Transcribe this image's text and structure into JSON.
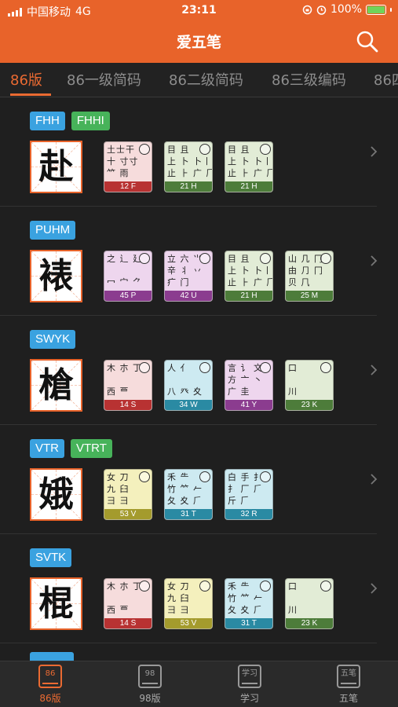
{
  "status": {
    "carrier": "中国移动",
    "network": "4G",
    "time": "23:11",
    "battery": "100%"
  },
  "nav": {
    "title": "爱五笔"
  },
  "tabs": [
    "86版",
    "86一级简码",
    "86二级简码",
    "86三级编码",
    "86四"
  ],
  "rows": [
    {
      "char": "赴",
      "codes": [
        {
          "text": "FHH",
          "color": "blue"
        },
        {
          "text": "FHHI",
          "color": "green"
        }
      ],
      "keys": [
        {
          "label": "12 F",
          "theme": "red",
          "glyphs": "土士干\n十 寸寸\n⺮ 雨"
        },
        {
          "label": "21 H",
          "theme": "green",
          "glyphs": "目 且\n上 卜 卜丨\n止 ⺊ 广 𠂆"
        },
        {
          "label": "21 H",
          "theme": "green",
          "glyphs": "目 且\n上 卜 卜丨\n止 ⺊ 广 𠂆"
        }
      ]
    },
    {
      "char": "裱",
      "codes": [
        {
          "text": "PUHM",
          "color": "blue"
        }
      ],
      "keys": [
        {
          "label": "45 P",
          "theme": "purple",
          "glyphs": "之 辶 廴\n\n冖 宀 ⺈"
        },
        {
          "label": "42 U",
          "theme": "purple",
          "glyphs": "立 六 ⺌\n辛 丬 丷\n疒 门"
        },
        {
          "label": "21 H",
          "theme": "green",
          "glyphs": "目 且\n上 卜 卜丨\n止 ⺊ 广 𠂆"
        },
        {
          "label": "25 M",
          "theme": "green",
          "glyphs": "山 几 冂\n由 ⺆ 冂\n贝 𠘨"
        }
      ]
    },
    {
      "char": "槍",
      "codes": [
        {
          "text": "SWYK",
          "color": "blue"
        }
      ],
      "keys": [
        {
          "label": "14 S",
          "theme": "red",
          "glyphs": "木 朩 丁\n\n西 覀"
        },
        {
          "label": "34 W",
          "theme": "blue",
          "glyphs": "人 亻\n\n八 癶 夊"
        },
        {
          "label": "41 Y",
          "theme": "purple",
          "glyphs": "言 讠 文\n方 亠 丶\n广 圭"
        },
        {
          "label": "23 K",
          "theme": "green",
          "glyphs": "口\n\n川"
        }
      ]
    },
    {
      "char": "娥",
      "codes": [
        {
          "text": "VTR",
          "color": "blue"
        },
        {
          "text": "VTRT",
          "color": "green"
        }
      ],
      "keys": [
        {
          "label": "53 V",
          "theme": "yellow",
          "glyphs": "女 刀\n九 臼\n彐 ⺕"
        },
        {
          "label": "31 T",
          "theme": "blue",
          "glyphs": "禾 ⺧\n竹 ⺮ 𠂉\n夂 夊 ⺁"
        },
        {
          "label": "32 R",
          "theme": "blue",
          "glyphs": "白 手 ⺘\n扌 厂 ⺁\n斤 𠂆"
        }
      ]
    },
    {
      "char": "棍",
      "codes": [
        {
          "text": "SVTK",
          "color": "blue"
        }
      ],
      "keys": [
        {
          "label": "14 S",
          "theme": "red",
          "glyphs": "木 朩 丁\n\n西 覀"
        },
        {
          "label": "53 V",
          "theme": "yellow",
          "glyphs": "女 刀\n九 臼\n彐 ⺕"
        },
        {
          "label": "31 T",
          "theme": "blue",
          "glyphs": "禾 ⺧\n竹 ⺮ 𠂉\n夂 夊 ⺁"
        },
        {
          "label": "23 K",
          "theme": "green",
          "glyphs": "口\n\n川"
        }
      ]
    }
  ],
  "bottom_nav": [
    {
      "icon_text": "86",
      "label": "86版",
      "active": true
    },
    {
      "icon_text": "98",
      "label": "98版",
      "active": false
    },
    {
      "icon_text": "学习",
      "label": "学习",
      "active": false
    },
    {
      "icon_text": "五笔",
      "label": "五笔",
      "active": false
    }
  ],
  "colors": {
    "accent": "#e8632a",
    "code_blue": "#3aa2e0",
    "code_green": "#47b35a"
  }
}
